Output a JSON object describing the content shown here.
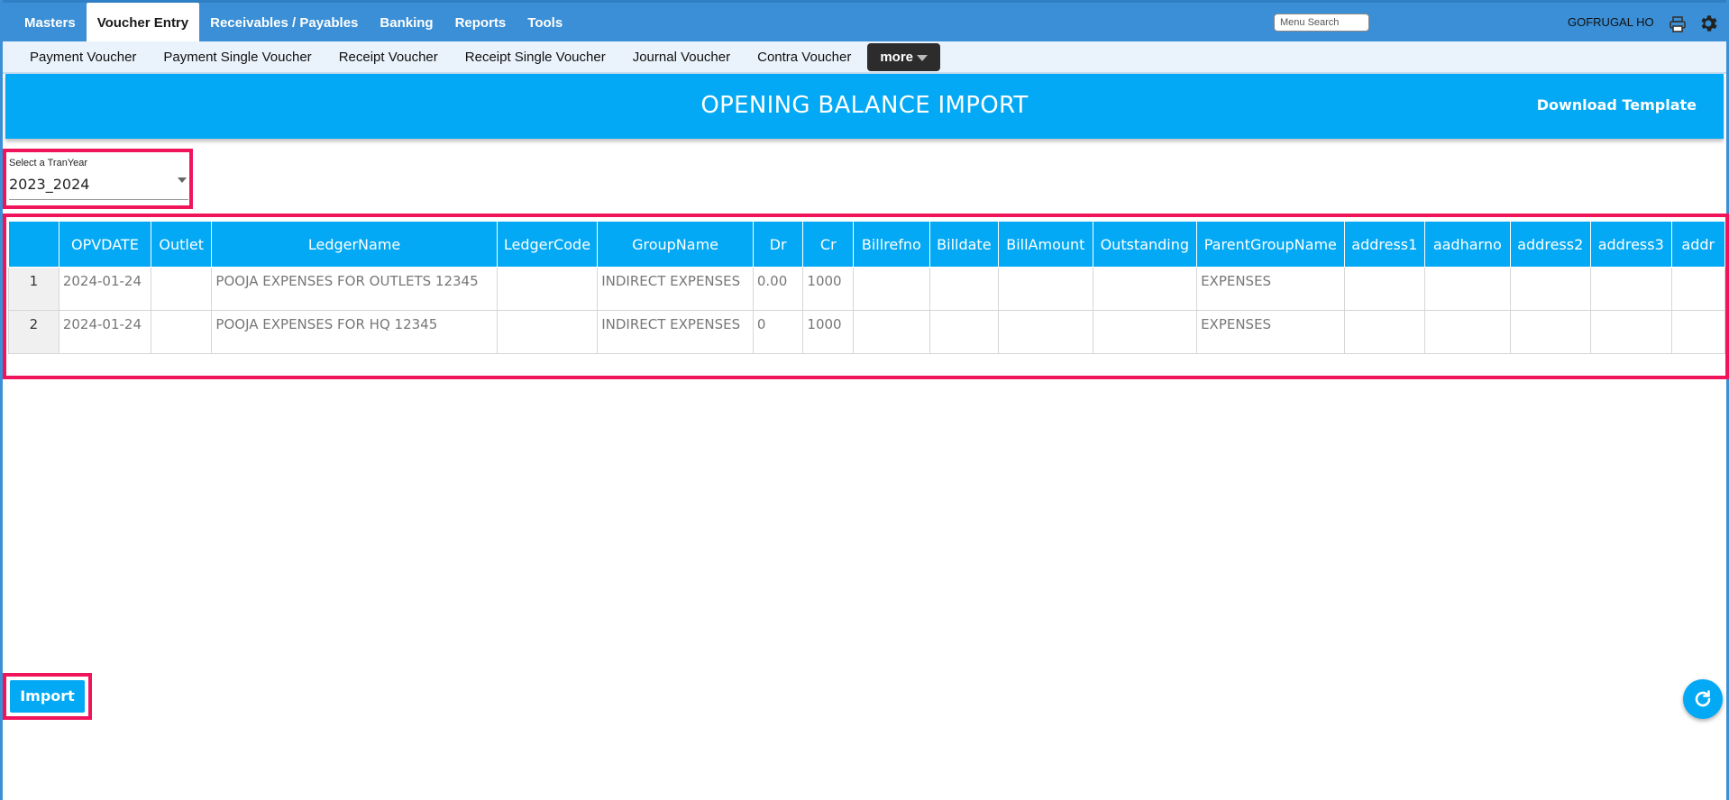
{
  "topnav": {
    "items": [
      {
        "label": "Masters",
        "active": false
      },
      {
        "label": "Voucher Entry",
        "active": true
      },
      {
        "label": "Receivables / Payables",
        "active": false
      },
      {
        "label": "Banking",
        "active": false
      },
      {
        "label": "Reports",
        "active": false
      },
      {
        "label": "Tools",
        "active": false
      }
    ],
    "search_placeholder": "Menu Search",
    "user": "GOFRUGAL HO",
    "icons": [
      "printer-icon",
      "gear-icon"
    ]
  },
  "subnav": {
    "items": [
      "Payment Voucher",
      "Payment Single Voucher",
      "Receipt Voucher",
      "Receipt Single Voucher",
      "Journal Voucher",
      "Contra Voucher"
    ],
    "more_label": "more"
  },
  "banner": {
    "title": "OPENING BALANCE IMPORT",
    "download_label": "Download Template"
  },
  "tranyear": {
    "label": "Select a TranYear",
    "value": "2023_2024"
  },
  "grid": {
    "columns": [
      "",
      "OPVDATE",
      "Outlet",
      "LedgerName",
      "LedgerCode",
      "GroupName",
      "Dr",
      "Cr",
      "Billrefno",
      "Billdate",
      "BillAmount",
      "Outstanding",
      "ParentGroupName",
      "address1",
      "aadharno",
      "address2",
      "address3",
      "addr"
    ],
    "rows": [
      [
        "1",
        "2024-01-24",
        "",
        "POOJA EXPENSES FOR OUTLETS 12345",
        "",
        "INDIRECT EXPENSES",
        "0.00",
        "1000",
        "",
        "",
        "",
        "",
        "EXPENSES",
        "",
        "",
        "",
        "",
        ""
      ],
      [
        "2",
        "2024-01-24",
        "",
        "POOJA EXPENSES FOR HQ 12345",
        "",
        "INDIRECT EXPENSES",
        "0",
        "1000",
        "",
        "",
        "",
        "",
        "EXPENSES",
        "",
        "",
        "",
        "",
        ""
      ]
    ]
  },
  "import_label": "Import",
  "colors": {
    "nav_blue": "#3a8fd6",
    "accent": "#03a9f4",
    "highlight": "#f0145a"
  }
}
